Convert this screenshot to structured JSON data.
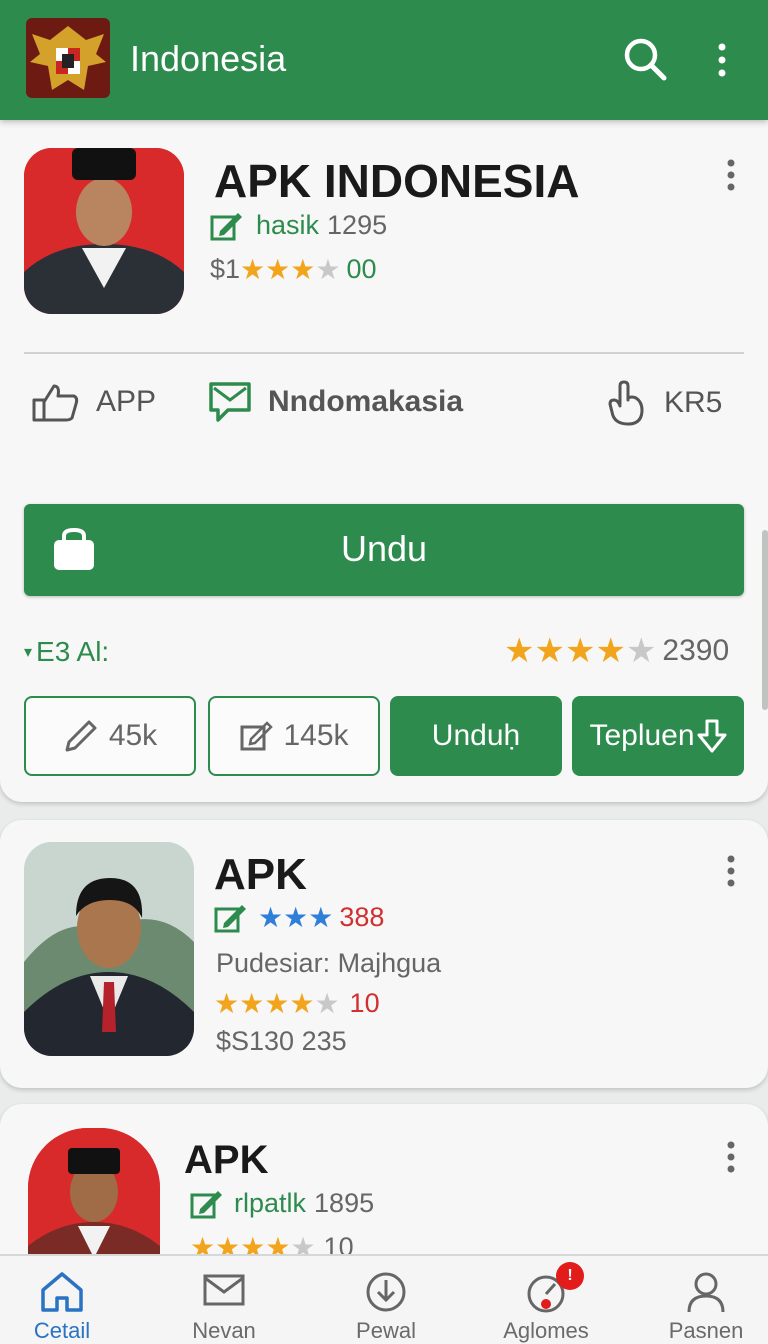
{
  "app_bar": {
    "title": "Indonesia",
    "logo_icon": "garuda-emblem-icon",
    "color": "#2e8b4e"
  },
  "featured": {
    "name": "APK INDONESIA",
    "author_label": "hasik",
    "author_count": "1295",
    "price_prefix": "$1",
    "price_suffix": "00",
    "rating_stars": 3.5,
    "meta": [
      {
        "icon": "thumbs-up-icon",
        "label": "APP"
      },
      {
        "icon": "message-icon",
        "label": "Nndomakasia"
      },
      {
        "icon": "hand-icon",
        "label": "KR5"
      }
    ],
    "download_button": "Undu",
    "section_label": "E3 Al:",
    "section_rating_stars": 4,
    "section_rating_count": "2390",
    "actions": [
      {
        "label": "45k",
        "icon": "pencil-icon",
        "style": "outline"
      },
      {
        "label": "145k",
        "icon": "edit-icon",
        "style": "outline"
      },
      {
        "label": "Unduḥ",
        "style": "filled"
      },
      {
        "label": "Tepluen",
        "icon": "download-arrow-icon",
        "style": "filled"
      }
    ]
  },
  "list": [
    {
      "name": "APK",
      "rating_stars": 2.5,
      "rating_count": "388",
      "publisher": "Pudesiar: Majhgua",
      "stars": 4,
      "stars_count": "10",
      "price": "$S130 235"
    },
    {
      "name": "APK",
      "author_label": "rlpatlk",
      "author_count": "1895",
      "stars": 4,
      "stars_count": "10"
    }
  ],
  "bottom_nav": [
    {
      "label": "Cetail",
      "icon": "home-icon",
      "active": true
    },
    {
      "label": "Nevan",
      "icon": "mail-icon",
      "active": false
    },
    {
      "label": "Pewal",
      "icon": "download-icon",
      "active": false
    },
    {
      "label": "Aglomes",
      "icon": "gauge-icon",
      "active": false,
      "badge": "!"
    },
    {
      "label": "Pasnen",
      "icon": "person-icon",
      "active": false
    }
  ]
}
